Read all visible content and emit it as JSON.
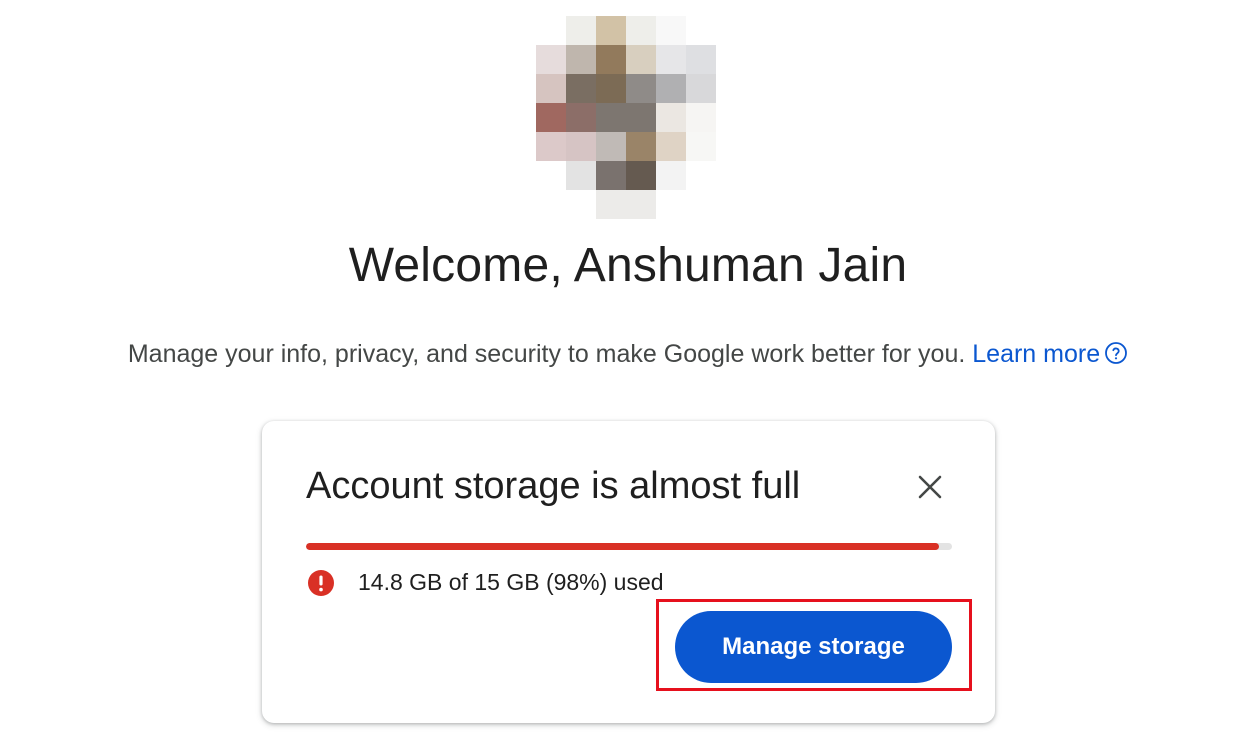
{
  "header": {
    "avatar_label": "profile-picture",
    "welcome_text": "Welcome, Anshuman Jain",
    "subtitle_text": "Manage your info, privacy, and security to make Google work better for you.",
    "learn_more_label": "Learn more",
    "help_icon": "help-circle-icon"
  },
  "storage_card": {
    "title": "Account storage is almost full",
    "close_icon": "close-icon",
    "usage_percent": 98,
    "usage_text": "14.8 GB of 15 GB (98%) used",
    "alert_icon": "error-icon",
    "manage_button_label": "Manage storage"
  },
  "colors": {
    "accent_blue": "#0b57d0",
    "alert_red": "#d93025",
    "highlight_red": "#e6101d",
    "avatar_pixels": [
      "#ffffff",
      "#eeeeea",
      "#d2c2a6",
      "#eeeeea",
      "#f8f8f8",
      "#ffffff",
      "#e6dcdc",
      "#bfb6ad",
      "#927a5c",
      "#d8cfbf",
      "#e6e6e8",
      "#dedfe2",
      "#d6c4c0",
      "#7a6e62",
      "#7c6b55",
      "#8f8b88",
      "#b0b0b2",
      "#d8d8da",
      "#a06860",
      "#8c6e68",
      "#7d7670",
      "#7d7670",
      "#ebe7e2",
      "#f6f5f3",
      "#dcc9c9",
      "#d6c4c4",
      "#c0bab6",
      "#9a8468",
      "#dfd3c5",
      "#f7f7f5",
      "#ffffff",
      "#e3e3e3",
      "#7a726e",
      "#655a50",
      "#f3f3f3",
      "#ffffff",
      "#ffffff",
      "#ffffff",
      "#ecebe9",
      "#ecebe9",
      "#ffffff",
      "#ffffff"
    ]
  }
}
